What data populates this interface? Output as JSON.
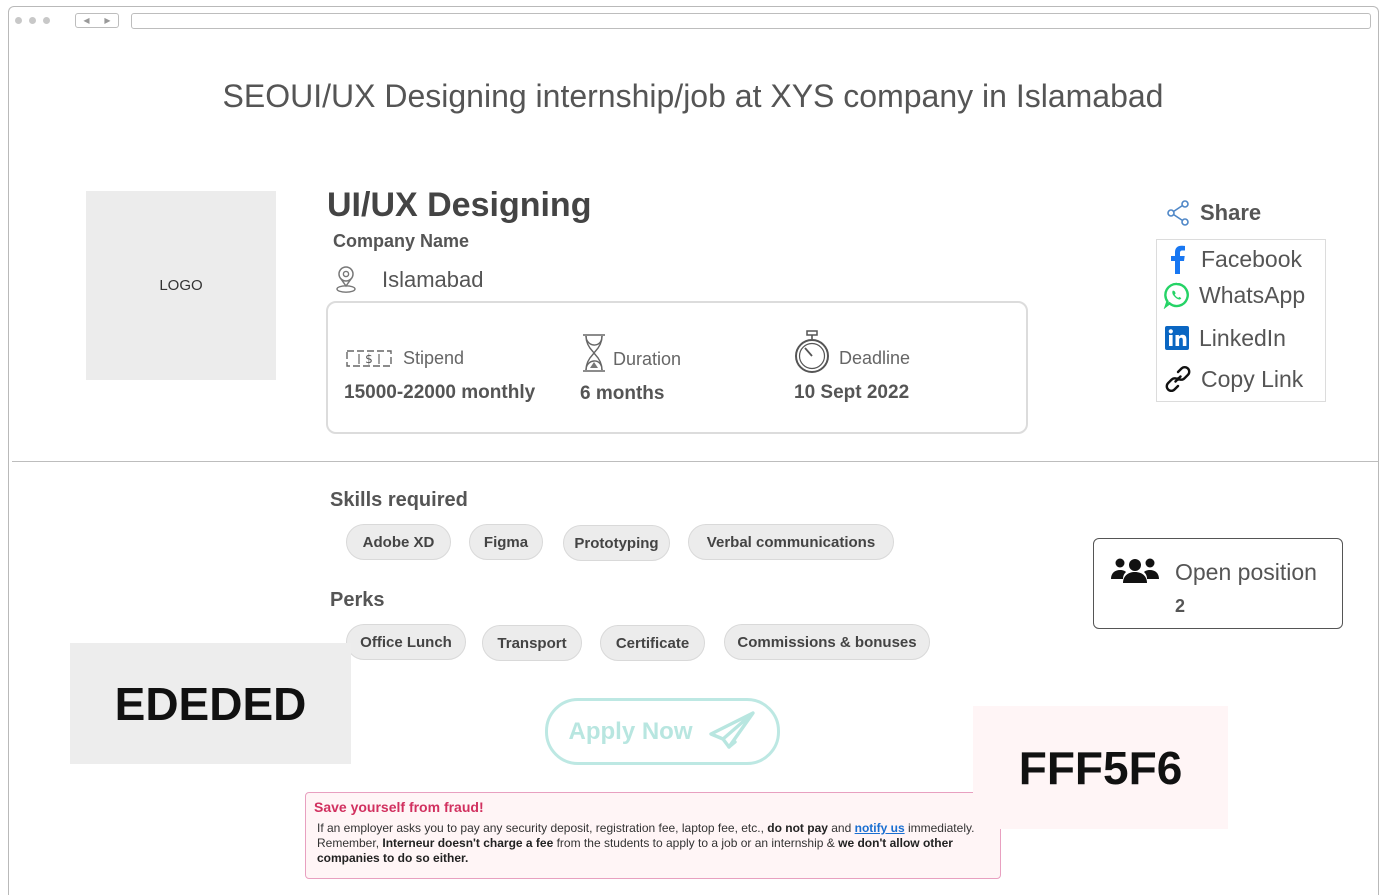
{
  "browser": {
    "nav_back": "◀",
    "nav_forward": "▶"
  },
  "page_title": "SEOUI/UX Designing internship/job at XYS company in Islamabad",
  "logo_text": "LOGO",
  "job": {
    "title": "UI/UX Designing",
    "company": "Company Name",
    "location": "Islamabad"
  },
  "info": {
    "stipend_label": "Stipend",
    "stipend_value": "15000-22000 monthly",
    "duration_label": "Duration",
    "duration_value": "6 months",
    "deadline_label": "Deadline",
    "deadline_value": "10 Sept 2022"
  },
  "share": {
    "label": "Share",
    "items": [
      {
        "label": "Facebook",
        "icon": "facebook-icon"
      },
      {
        "label": "WhatsApp",
        "icon": "whatsapp-icon"
      },
      {
        "label": "LinkedIn",
        "icon": "linkedin-icon"
      },
      {
        "label": "Copy Link",
        "icon": "link-icon"
      }
    ]
  },
  "skills": {
    "heading": "Skills required",
    "tags": [
      "Adobe XD",
      "Figma",
      "Prototyping",
      "Verbal communications"
    ]
  },
  "perks": {
    "heading": "Perks",
    "tags": [
      "Office Lunch",
      "Transport",
      "Certificate",
      "Commissions & bonuses"
    ]
  },
  "open_position": {
    "label": "Open position",
    "count": "2"
  },
  "apply_label": "Apply Now",
  "swatches": {
    "gray": "EDEDED",
    "pink": "FFF5F6"
  },
  "colors": {
    "gray_swatch": "#EDEDED",
    "pink_swatch": "#FFF5F6",
    "apply_accent": "#BDE8E3",
    "fraud_title": "#D1305F",
    "link": "#1A6FD1"
  },
  "fraud": {
    "title": "Save yourself from fraud!",
    "t1": "If an employer asks you to pay any security deposit, registration fee, laptop fee, etc., ",
    "b1": "do not pay",
    "t2": " and ",
    "link": "notify us",
    "t3": " immediately. Remember, ",
    "b2": "Interneur doesn't charge a fee",
    "t4": " from the students to apply to a job or an internship & ",
    "b3": "we don't allow other companies to do so either."
  }
}
